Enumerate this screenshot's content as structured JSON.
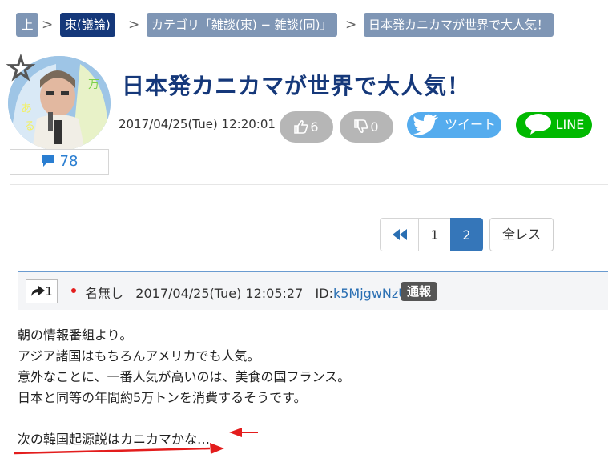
{
  "breadcrumb": [
    {
      "label": "上"
    },
    {
      "label": "東(議論)"
    },
    {
      "label": "カテゴリ「雑談(東) − 雑談(同)」"
    },
    {
      "label": "日本発カニカマが世界で大人気！"
    }
  ],
  "thread": {
    "title": "日本発カニカマが世界で大人気！",
    "date": "2017/04/25(Tue) 12:20:01",
    "comment_count": "78",
    "likes": "6",
    "dislikes": "0",
    "tweet_label": "ツイート",
    "line_label": "LINE"
  },
  "pagination": {
    "pages": [
      "1",
      "2"
    ],
    "current": "2",
    "all_label": "全レス"
  },
  "post": {
    "number": "1",
    "name": "名無し",
    "date": "2017/04/25(Tue) 12:05:27",
    "id_label": "ID:",
    "id_value": "k5MjgwNzU",
    "report_label": "通報",
    "lines": [
      "朝の情報番組より。",
      "アジア諸国はもちろんアメリカでも人気。",
      "意外なことに、一番人気が高いのは、美食の国フランス。",
      "日本と同等の年間約5万トンを消費するそうです。",
      "",
      "次の韓国起源説はカニカマかな…"
    ]
  },
  "colors": {
    "crumb": "#7f96b5",
    "crumb_active": "#15387a",
    "title": "#15387a",
    "tweet": "#55acee",
    "line": "#00b900",
    "pager_active": "#3576b9",
    "annotation": "#e31d1d"
  }
}
